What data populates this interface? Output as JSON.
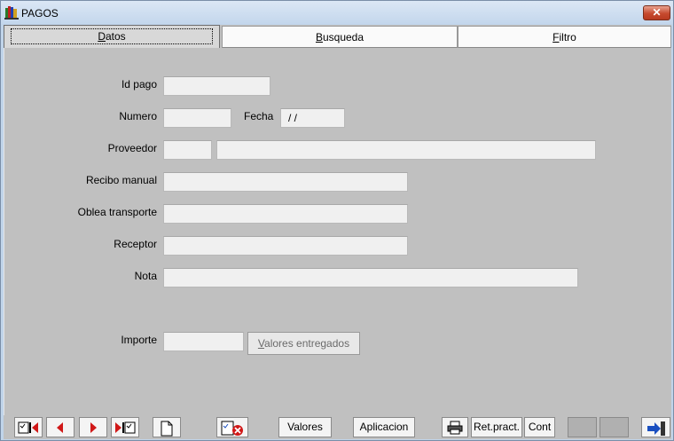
{
  "window": {
    "title": "PAGOS",
    "close_label": "✕"
  },
  "tabs": [
    {
      "label": "Datos",
      "accel": "D",
      "rest": "atos"
    },
    {
      "label": "Busqueda",
      "accel": "B",
      "rest": "usqueda"
    },
    {
      "label": "Filtro",
      "accel": "F",
      "rest": "iltro"
    }
  ],
  "form": {
    "id_pago_label": "Id pago",
    "id_pago_value": "",
    "numero_label": "Numero",
    "numero_value": "",
    "fecha_label": "Fecha",
    "fecha_value": "/ /",
    "proveedor_label": "Proveedor",
    "proveedor_code": "",
    "proveedor_name": "",
    "recibo_label": "Recibo manual",
    "recibo_value": "",
    "oblea_label": "Oblea transporte",
    "oblea_value": "",
    "receptor_label": "Receptor",
    "receptor_value": "",
    "nota_label": "Nota",
    "nota_value": "",
    "importe_label": "Importe",
    "importe_value": "",
    "valores_btn_accel": "V",
    "valores_btn_rest": "alores entregados"
  },
  "toolbar": {
    "valores": "Valores",
    "aplicacion": "Aplicacion",
    "ret_pract": "Ret.pract.",
    "cont": "Cont"
  },
  "colors": {
    "form_bg": "#c0c0c0",
    "field_bg": "#f0f0f0",
    "title_bg": "#c3d6ec",
    "close_red": "#c64a2e",
    "nav_red": "#d01818"
  }
}
